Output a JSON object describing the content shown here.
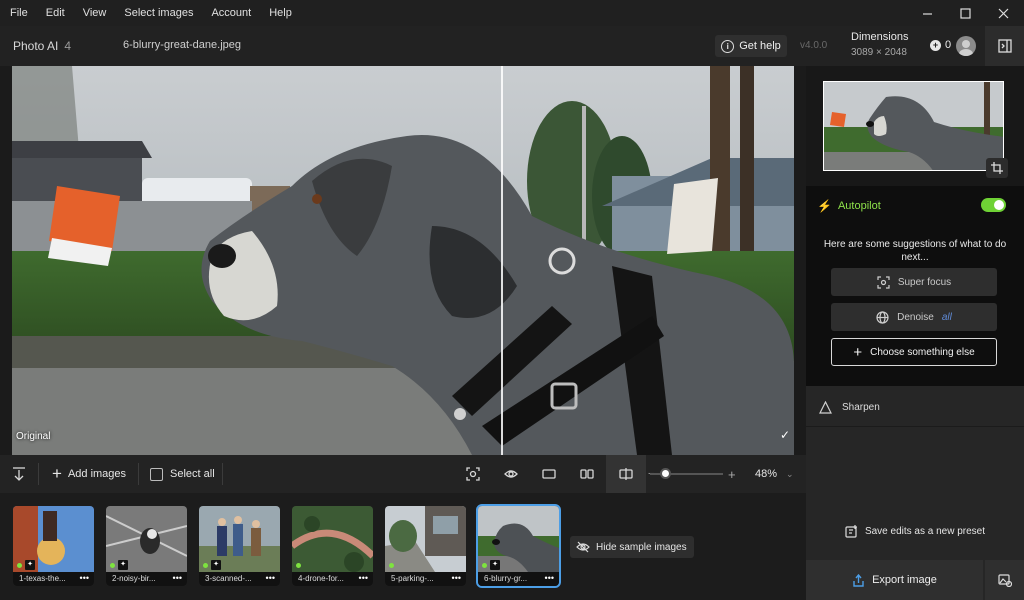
{
  "menu": [
    "File",
    "Edit",
    "View",
    "Select images",
    "Account",
    "Help"
  ],
  "app": {
    "name": "Photo AI",
    "version_badge": "4",
    "file_name": "6-blurry-great-dane.jpeg",
    "get_help": "Get help",
    "version": "v4.0.0",
    "dimensions_label": "Dimensions",
    "dimensions_value": "3089 × 2048",
    "credits": "0"
  },
  "canvas": {
    "original_label": "Original",
    "check": "✓"
  },
  "toolbar": {
    "add_images": "Add images",
    "select_all": "Select all",
    "zoom_plus": "+",
    "zoom_minus": "−",
    "zoom_value": "48%",
    "zoom_level_percent": 48
  },
  "thumbnails": [
    {
      "caption": "1-texas-the...",
      "more": "•••"
    },
    {
      "caption": "2-noisy-bir...",
      "more": "•••"
    },
    {
      "caption": "3-scanned-...",
      "more": "•••"
    },
    {
      "caption": "4-drone-for...",
      "more": "•••"
    },
    {
      "caption": "5-parking-...",
      "more": "•••"
    },
    {
      "caption": "6-blurry-gr...",
      "more": "•••"
    }
  ],
  "hide_samples": "Hide sample images",
  "panel": {
    "autopilot": "Autopilot",
    "hint": "Here are some suggestions of what to do next...",
    "super_focus": "Super focus",
    "denoise": "Denoise",
    "denoise_tag": "all",
    "choose_else": "Choose something else",
    "sharpen": "Sharpen",
    "save_preset": "Save edits as a new preset",
    "export": "Export image"
  },
  "colors": {
    "accent_green": "#6fd235",
    "accent_blue": "#4c9ee6",
    "background": "#1b1b1b"
  }
}
